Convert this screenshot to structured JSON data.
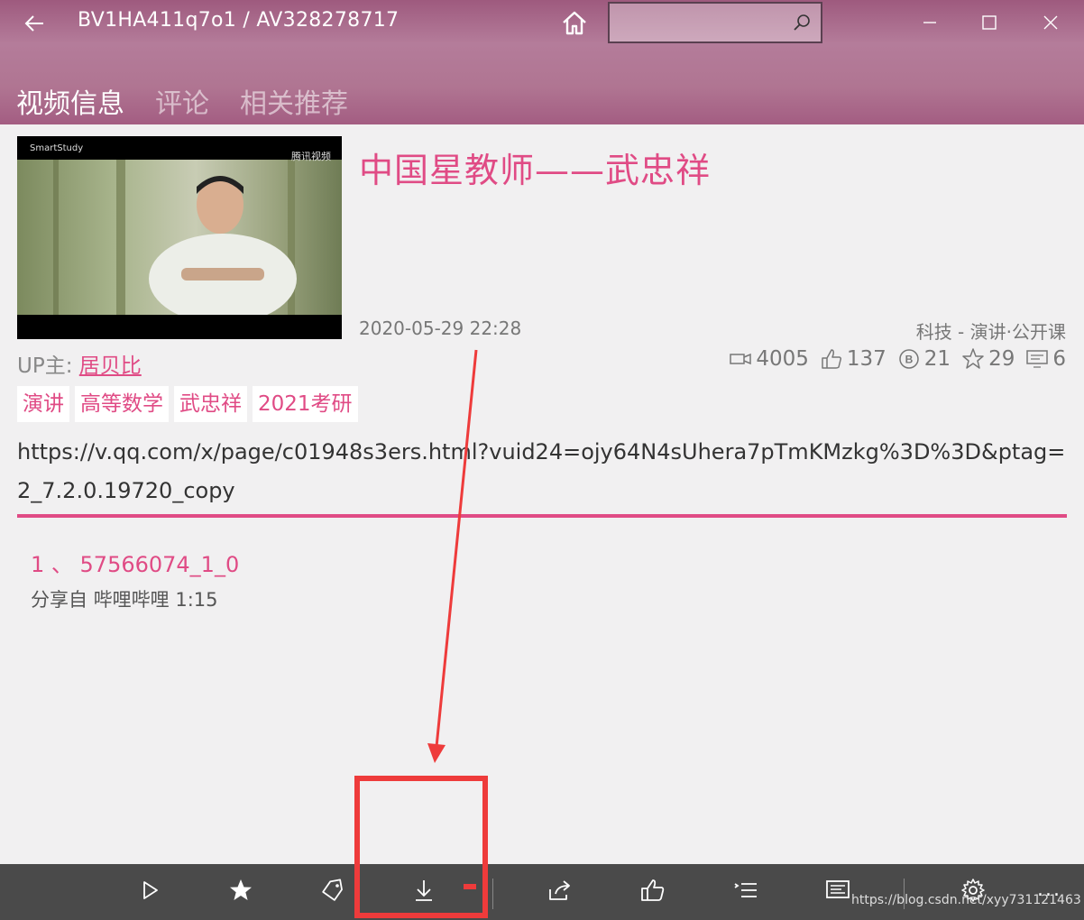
{
  "window": {
    "title": "BV1HA411q7o1 / AV328278717",
    "search_placeholder": ""
  },
  "tabs": [
    {
      "label": "视频信息",
      "active": true
    },
    {
      "label": "评论",
      "active": false
    },
    {
      "label": "相关推荐",
      "active": false
    }
  ],
  "video": {
    "title": "中国星教师——武忠祥",
    "date": "2020-05-29 22:28",
    "category": "科技 - 演讲·公开课",
    "up_label": "UP主:",
    "up_name": "居贝比",
    "thumbnail_logo_left": "SmartStudy",
    "thumbnail_logo_right": "腾讯视频"
  },
  "stats": {
    "views": "4005",
    "likes": "137",
    "coins": "21",
    "favorites": "29",
    "danmaku": "6"
  },
  "tags": [
    "演讲",
    "高等数学",
    "武忠祥",
    "2021考研"
  ],
  "description": "https://v.qq.com/x/page/c01948s3ers.html?vuid24=ojy64N4sUhera7pTmKMzkg%3D%3D&ptag=2_7.2.0.19720_copy",
  "parts": [
    {
      "title": "1 、 57566074_1_0",
      "subtitle": "分享自 哔哩哔哩 1:15"
    }
  ],
  "appbar": {
    "buttons": [
      "play-icon",
      "star-icon",
      "tag-icon",
      "download-icon",
      "share-icon",
      "thumbs-up-icon",
      "list-icon",
      "danmaku-icon",
      "settings-icon"
    ],
    "more_label": "..."
  },
  "watermark": "https://blog.csdn.net/xyy731121463",
  "colors": {
    "accent": "#e04b85",
    "titlebar": "#a8678a",
    "appbar": "#4a4a4a",
    "annotation": "#ee3b3b"
  }
}
